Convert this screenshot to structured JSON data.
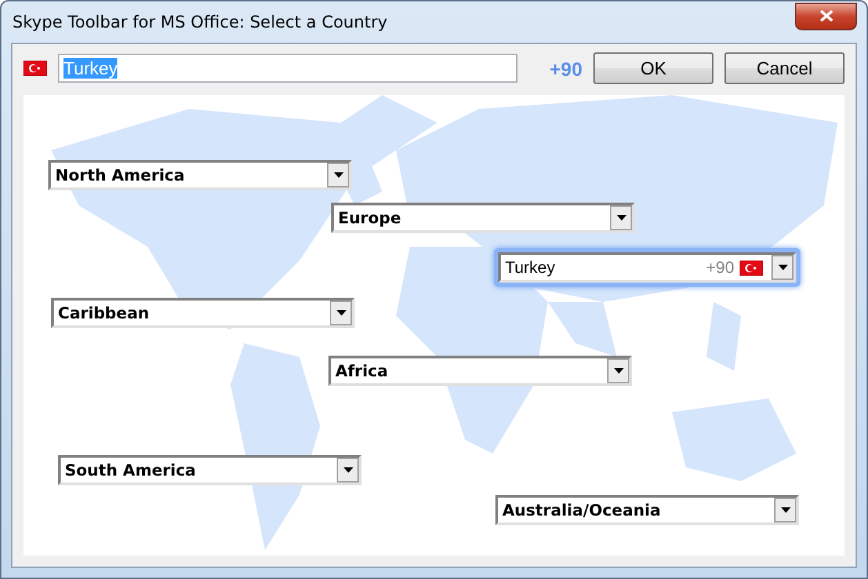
{
  "window": {
    "title": "Skype Toolbar for MS Office: Select a Country"
  },
  "search": {
    "value": "Turkey",
    "code": "+90"
  },
  "buttons": [
    "OK",
    "Cancel"
  ],
  "regions": [
    {
      "label": "North America",
      "kind": "region"
    },
    {
      "label": "Europe",
      "kind": "region"
    },
    {
      "label": "Turkey",
      "code": "+90",
      "kind": "country"
    },
    {
      "label": "Caribbean",
      "kind": "region"
    },
    {
      "label": "Africa",
      "kind": "region"
    },
    {
      "label": "South America",
      "kind": "region"
    },
    {
      "label": "Australia/Oceania",
      "kind": "region"
    }
  ]
}
